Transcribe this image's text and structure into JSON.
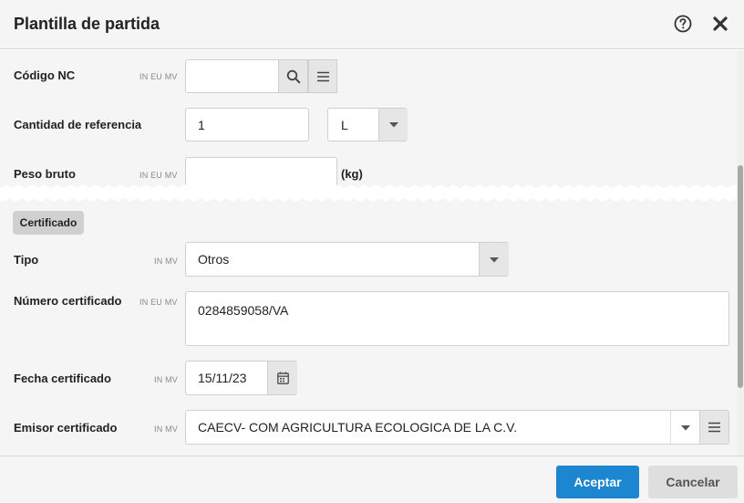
{
  "dialog": {
    "title": "Plantilla de partida",
    "help_icon": "question-circle-icon",
    "close_icon": "close-icon"
  },
  "fields": {
    "codigo_nc": {
      "label": "Código NC",
      "flags": "IN EU MV",
      "value": ""
    },
    "cantidad_referencia": {
      "label": "Cantidad de referencia",
      "value": "1",
      "unit": "L"
    },
    "peso_bruto": {
      "label": "Peso bruto",
      "flags": "IN EU MV",
      "value": "",
      "unit": "(kg)"
    }
  },
  "certificado": {
    "section_label": "Certificado",
    "tipo": {
      "label": "Tipo",
      "flags": "IN MV",
      "value": "Otros"
    },
    "numero": {
      "label": "Número certificado",
      "flags": "IN EU MV",
      "value": "0284859058/VA"
    },
    "fecha": {
      "label": "Fecha certificado",
      "flags": "IN MV",
      "value": "15/11/23"
    },
    "emisor": {
      "label": "Emisor certificado",
      "flags": "IN MV",
      "value": "CAECV- COM AGRICULTURA ECOLOGICA DE LA C.V."
    }
  },
  "footer": {
    "accept_label": "Aceptar",
    "cancel_label": "Cancelar"
  },
  "colors": {
    "accent": "#1d86d0",
    "background": "#f5f5f5",
    "button_grey": "#dedede"
  }
}
